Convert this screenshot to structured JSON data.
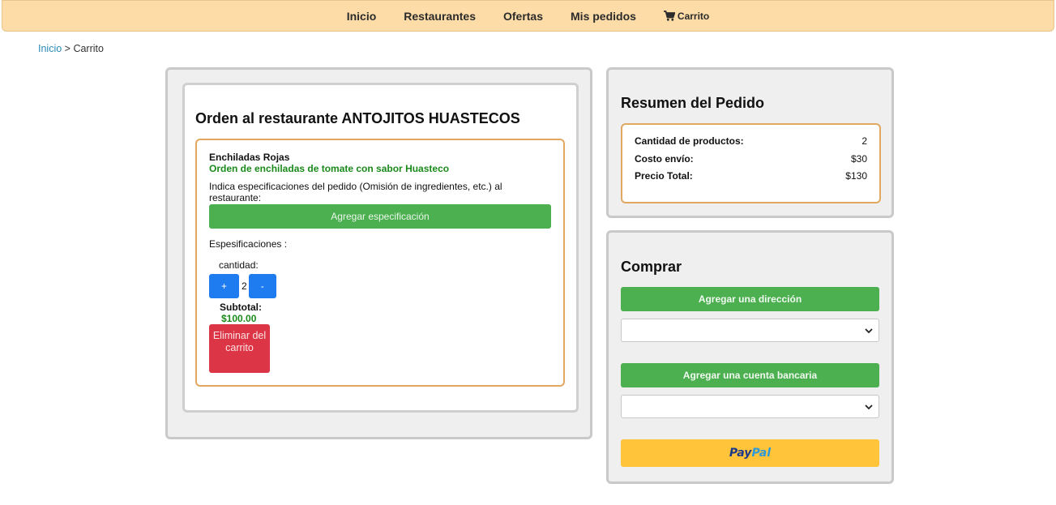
{
  "nav": {
    "items": [
      "Inicio",
      "Restaurantes",
      "Ofertas",
      "Mis pedidos"
    ],
    "cart_label": "Carrito",
    "cart_icon": "shopping-cart-icon"
  },
  "breadcrumb": {
    "home": "Inicio",
    "separator": " > ",
    "current": "Carrito"
  },
  "order": {
    "title": "Orden al restaurante ANTOJITOS HUASTECOS",
    "item": {
      "name": "Enchiladas Rojas",
      "description": "Orden de enchiladas de tomate con sabor Huasteco",
      "hint": "Indica especificaciones del pedido (Omisión de ingredientes, etc.) al restaurante:",
      "add_spec_label": "Agregar especificación",
      "specs_label": "Espesificaciones :",
      "qty_label": "cantidad:",
      "plus_label": "+",
      "quantity": "2",
      "minus_label": "-",
      "subtotal_label": "Subtotal:",
      "subtotal_value": "$100.00",
      "remove_label": "Eliminar del carrito"
    }
  },
  "summary": {
    "title": "Resumen del Pedido",
    "rows": [
      {
        "label": "Cantidad de productos:",
        "value": "2"
      },
      {
        "label": "Costo envío:",
        "value": "$30"
      },
      {
        "label": "Precio Total:",
        "value": "$130"
      }
    ]
  },
  "buy": {
    "title": "Comprar",
    "add_address_label": "Agregar una dirección",
    "address_selected": "",
    "add_account_label": "Agregar una cuenta bancaria",
    "account_selected": "",
    "paypal_part1": "Pay",
    "paypal_part2": "Pal"
  },
  "colors": {
    "nav_bg": "#fddca8",
    "green": "#4caf50",
    "blue": "#1e7cf0",
    "red": "#dc3545",
    "paypal_yellow": "#ffc43a",
    "accent_border": "#e0a860"
  }
}
